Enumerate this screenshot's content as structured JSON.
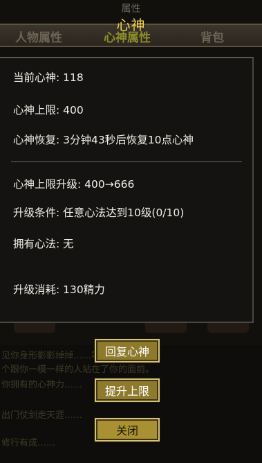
{
  "background": {
    "title": "属性",
    "tabs": [
      "人物属性",
      "心神属性",
      "背包"
    ],
    "text_lines": [
      "见你身形影影绰绰……等你回过神来,",
      "个跟你一模一样的人站在了你的面前。",
      "你拥有的心神力……",
      "出门仗剑走天涯……",
      "修行有成……"
    ]
  },
  "dialog": {
    "title": "心神",
    "current_label": "当前心神:",
    "current_value": "118",
    "cap_label": "心神上限:",
    "cap_value": "400",
    "recover_label": "心神恢复:",
    "recover_value": "3分钟43秒后恢复10点心神",
    "upgrade_label": "心神上限升级:",
    "upgrade_value": "400→666",
    "condition_label": "升级条件:",
    "condition_value": "任意心法达到10级(0/10)",
    "owned_label": "拥有心法:",
    "owned_value": "无",
    "cost_label": "升级消耗:",
    "cost_value": "130精力"
  },
  "buttons": {
    "recover": "回复心神",
    "upgrade": "提升上限",
    "close": "关闭"
  }
}
